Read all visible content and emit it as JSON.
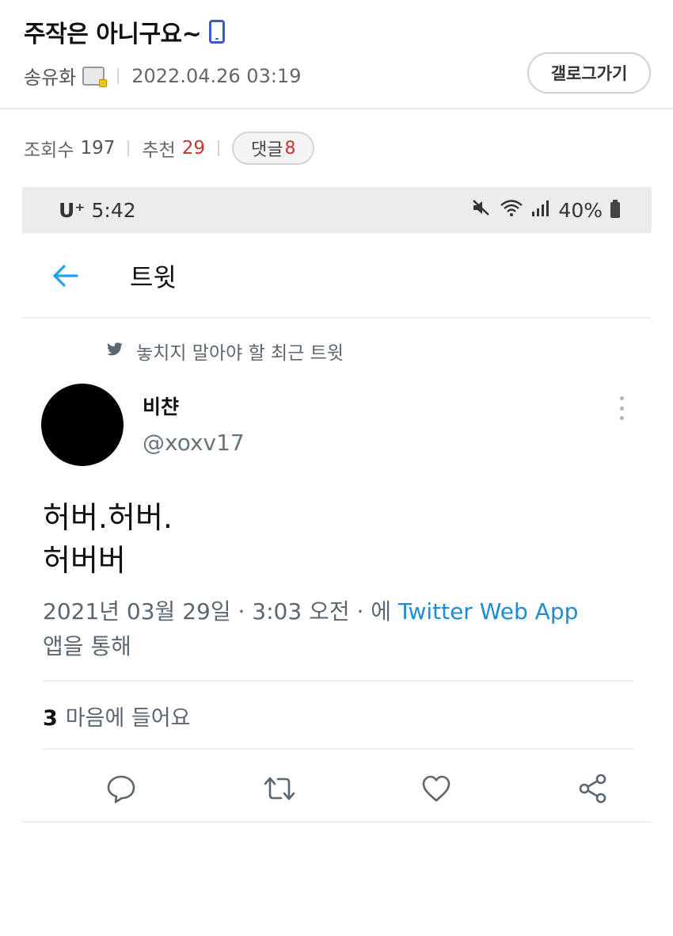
{
  "post": {
    "title": "주작은 아니구요~",
    "author": "송유화",
    "datetime": "2022.04.26 03:19",
    "gallery_button": "갤로그가기",
    "views_label": "조회수",
    "views": "197",
    "recommend_label": "추천",
    "recommend": "29",
    "comments_label": "댓글",
    "comments": "8"
  },
  "phone": {
    "carrier": "U⁺",
    "time": "5:42",
    "battery": "40%"
  },
  "twitter": {
    "nav_title": "트윗",
    "pinned_label": "놓치지 말아야 할 최근 트윗",
    "display_name": "비챤",
    "handle": "@xoxv17",
    "tweet_line1": "허버.허버.",
    "tweet_line2": "허버버",
    "timestamp": "2021년 03월 29일 · 3:03 오전 · 에 ",
    "source": "Twitter Web App",
    "timestamp_suffix": "앱을 통해",
    "likes_count": "3",
    "likes_label": "마음에 들어요"
  },
  "icons": {
    "mobile": "mobile-icon",
    "badge": "gallery-badge-icon",
    "mute": "mute-icon",
    "wifi": "wifi-icon",
    "signal": "signal-icon",
    "battery": "battery-icon",
    "back": "back-arrow-icon",
    "bird": "twitter-bird-icon",
    "more": "more-vertical-icon",
    "reply": "reply-icon",
    "retweet": "retweet-icon",
    "like": "heart-icon",
    "share": "share-icon"
  },
  "colors": {
    "accent_red": "#c63434",
    "twitter_blue": "#1da1f2",
    "link_blue": "#1a8cd8",
    "muted_gray": "#5b6770",
    "mobile_icon_blue": "#3b5cc6"
  }
}
